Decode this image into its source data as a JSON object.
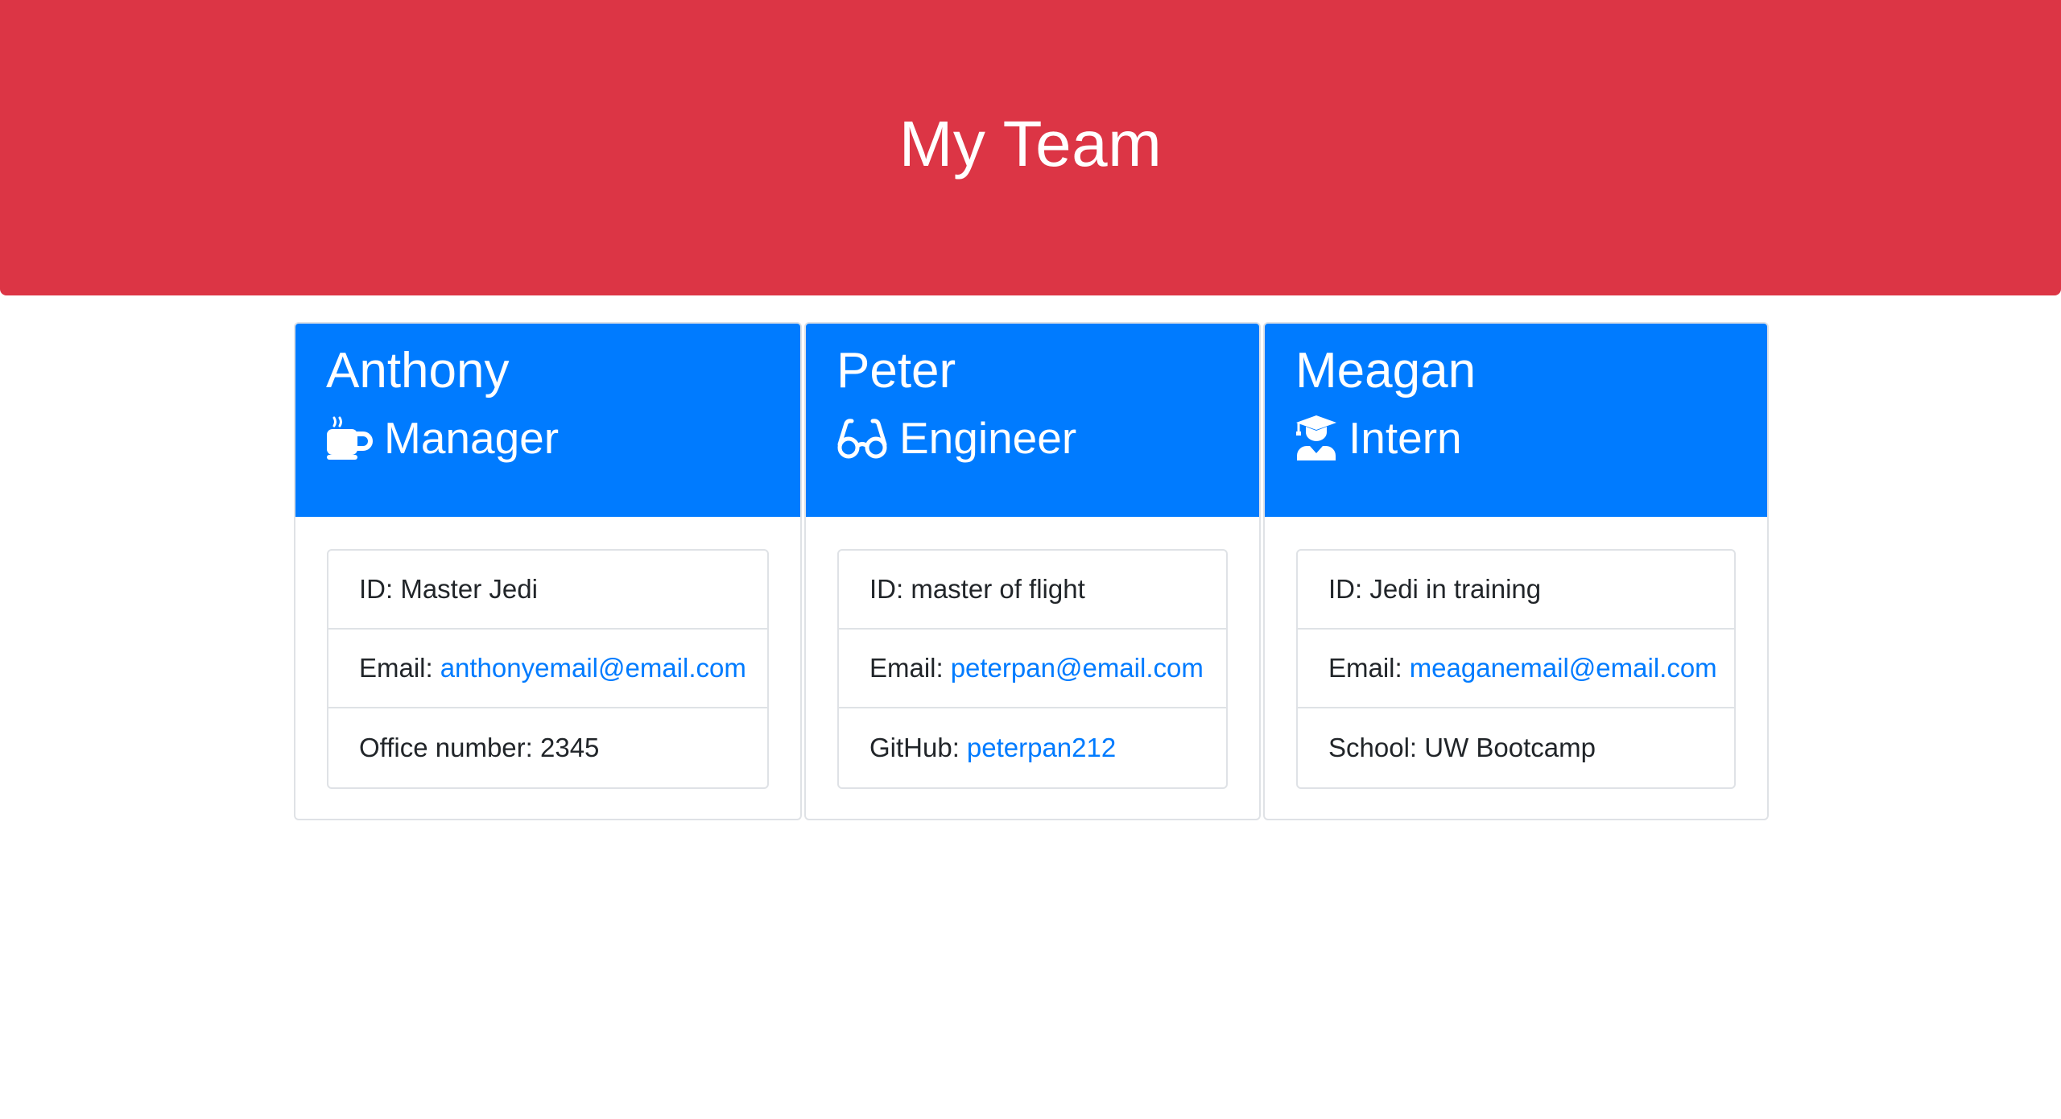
{
  "header": {
    "title": "My Team"
  },
  "employees": [
    {
      "name": "Anthony",
      "role": "Manager",
      "role_icon": "coffee-icon",
      "id_label": "ID: ",
      "id_value": "Master Jedi",
      "email_label": "Email:",
      "email": "anthonyemail@email.com",
      "extra_label": "Office number: ",
      "extra_value": "2345"
    },
    {
      "name": "Peter",
      "role": "Engineer",
      "role_icon": "glasses-icon",
      "id_label": "ID: ",
      "id_value": "master of flight",
      "email_label": "Email:",
      "email": "peterpan@email.com",
      "extra_label": "GitHub:",
      "extra_value": "peterpan212"
    },
    {
      "name": "Meagan",
      "role": "Intern",
      "role_icon": "graduate-icon",
      "id_label": "ID: ",
      "id_value": "Jedi in training",
      "email_label": "Email:",
      "email": "meaganemail@email.com",
      "extra_label": "School: ",
      "extra_value": "UW Bootcamp"
    }
  ],
  "colors": {
    "header_bg": "#dc3545",
    "card_header_bg": "#007bff",
    "link": "#007bff"
  }
}
